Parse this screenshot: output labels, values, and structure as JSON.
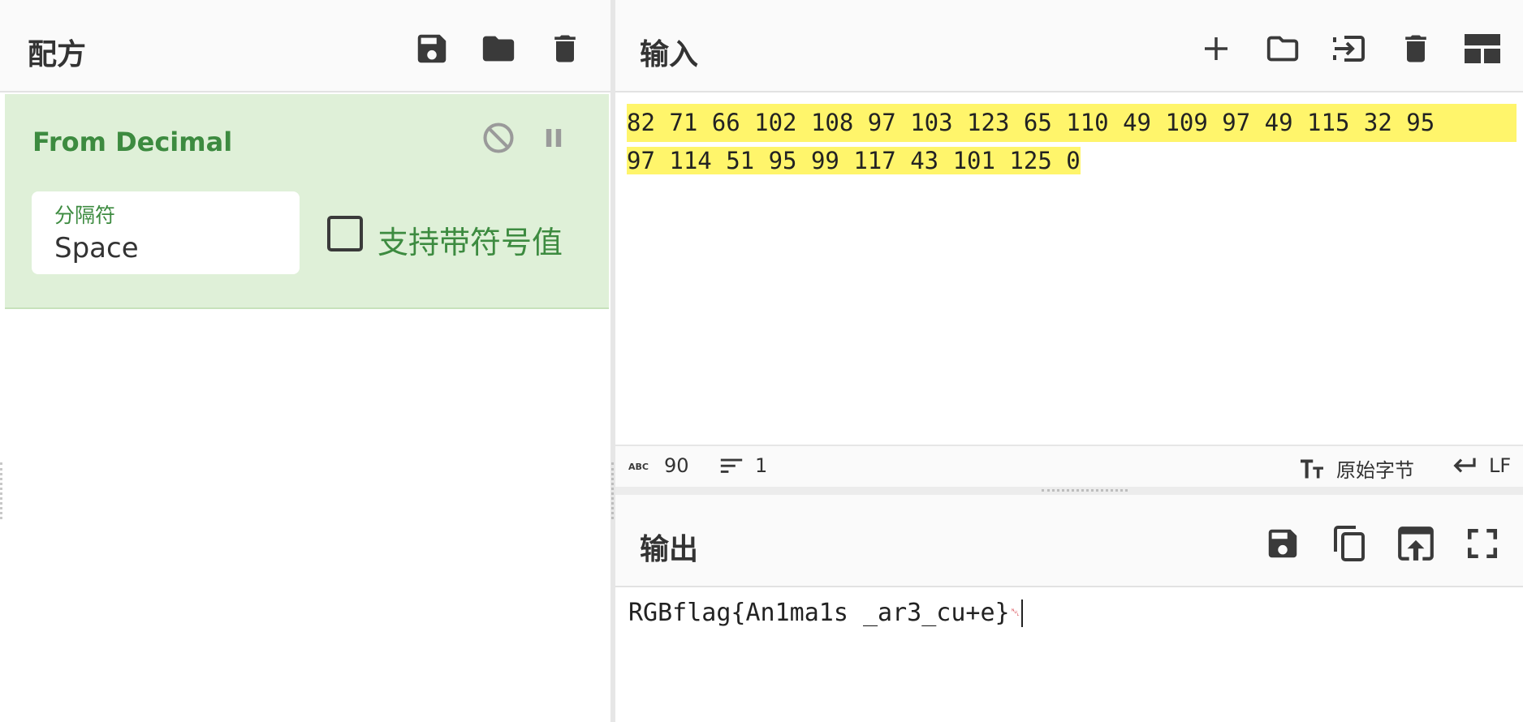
{
  "recipe": {
    "title": "配方",
    "icons": [
      "save-icon",
      "folder-icon",
      "trash-icon"
    ],
    "operation": {
      "name": "From Decimal",
      "delimiter_label": "分隔符",
      "delimiter_value": "Space",
      "signed_label": "支持带符号值",
      "signed_checked": false
    }
  },
  "input": {
    "title": "输入",
    "icons": [
      "plus-icon",
      "folder-icon",
      "import-icon",
      "trash-icon",
      "layout-icon"
    ],
    "lines": [
      "82 71 66 102 108 97 103 123 65 110 49 109 97 49 115 32 95",
      "97 114 51 95 99 117 43 101 125 0"
    ],
    "status": {
      "length": "90",
      "lines": "1",
      "encoding": "原始字节",
      "eol": "LF"
    }
  },
  "output": {
    "title": "输出",
    "icons": [
      "save-icon",
      "copy-icon",
      "replace-input-icon",
      "fullscreen-icon"
    ],
    "text": "RGBflag{An1ma1s _ar3_cu+e}",
    "nul_symbol": "␀"
  },
  "colors": {
    "operation_bg": "#dff0d8",
    "operation_text": "#3d8b40",
    "highlight": "#fff56b",
    "icon": "#3a3a3a"
  }
}
